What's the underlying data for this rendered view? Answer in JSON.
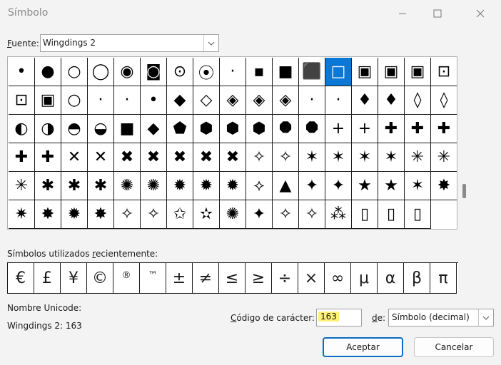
{
  "window": {
    "title": "Símbolo"
  },
  "font": {
    "label_prefix": "",
    "label_underlined": "F",
    "label_rest": "uente:",
    "value": "Wingdings 2"
  },
  "symbols": [
    "•",
    "●",
    "○",
    "◯",
    "◉",
    "◙",
    "⊙",
    "⦿",
    "·",
    "▪",
    "■",
    "⬛",
    "□",
    "▣",
    "▣",
    "▣",
    "⊡",
    "⊡",
    "▣",
    "○",
    "·",
    "·",
    "•",
    "◆",
    "◇",
    "◈",
    "◈",
    "◈",
    "·",
    "·",
    "♦",
    "♦",
    "◊",
    "◊",
    "◐",
    "◑",
    "◓",
    "◒",
    "■",
    "◆",
    "⬟",
    "⬢",
    "⬢",
    "⬢",
    "⯃",
    "⯃",
    "+",
    "+",
    "✚",
    "✚",
    "✚",
    "✚",
    "✚",
    "✕",
    "✕",
    "✖",
    "✖",
    "✖",
    "✖",
    "✖",
    "✧",
    "✧",
    "✶",
    "✶",
    "✶",
    "✶",
    "✳",
    "✳",
    "✳",
    "✱",
    "✱",
    "✱",
    "✺",
    "✺",
    "✹",
    "✹",
    "✹",
    "⟡",
    "▲",
    "✦",
    "✦",
    "★",
    "★",
    "✶",
    "✸",
    "✷",
    "✸",
    "✹",
    "✸",
    "✧",
    "✧",
    "✩",
    "✫",
    "✺",
    "✦",
    "✧",
    "✧",
    "⁂",
    "▯",
    "▯",
    "▯"
  ],
  "selected_index": 12,
  "recent": {
    "label_prefix": "Símbolos utilizados ",
    "label_underlined": "r",
    "label_rest": "ecientemente:",
    "items": [
      "€",
      "£",
      "¥",
      "©",
      "®",
      "™",
      "±",
      "≠",
      "≤",
      "≥",
      "÷",
      "×",
      "∞",
      "μ",
      "α",
      "β",
      "π"
    ]
  },
  "unicode_name": {
    "label": "Nombre Unicode:",
    "value": "Wingdings 2: 163"
  },
  "char_code": {
    "label_prefix": "",
    "label_underlined": "C",
    "label_rest": "ódigo de carácter:",
    "value": "163"
  },
  "from": {
    "label_underlined": "d",
    "label_rest": "e:",
    "value": "Símbolo (decimal)"
  },
  "buttons": {
    "accept": "Aceptar",
    "cancel": "Cancelar"
  }
}
